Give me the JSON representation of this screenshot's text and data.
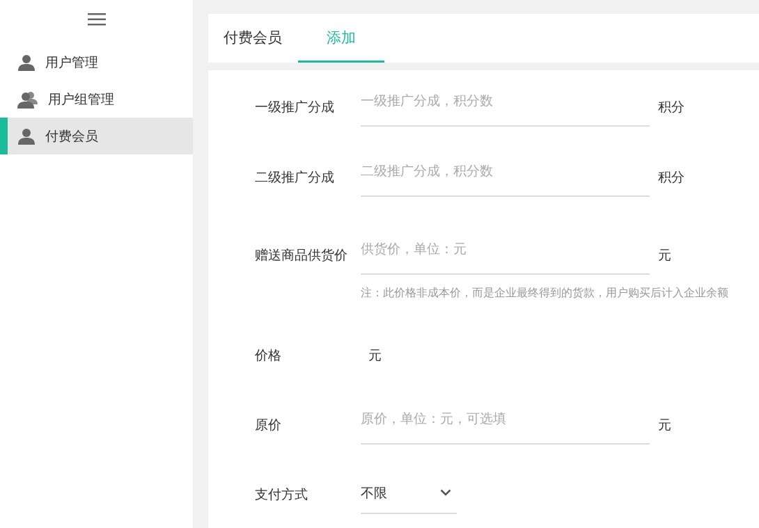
{
  "sidebar": {
    "items": [
      {
        "label": "用户管理",
        "kind": "user",
        "selected": false
      },
      {
        "label": "用户组管理",
        "kind": "group",
        "selected": false
      },
      {
        "label": "付费会员",
        "kind": "user",
        "selected": true
      }
    ]
  },
  "tabs": [
    {
      "label": "付费会员",
      "selected": false
    },
    {
      "label": "添加",
      "selected": true
    }
  ],
  "form": {
    "fields": [
      {
        "kind": "input",
        "label": "一级推广分成",
        "placeholder": "一级推广分成，积分数",
        "unit": "积分"
      },
      {
        "kind": "input",
        "label": "二级推广分成",
        "placeholder": "二级推广分成，积分数",
        "unit": "积分"
      },
      {
        "kind": "input",
        "label": "赠送商品供货价",
        "placeholder": "供货价，单位：元",
        "unit": "元",
        "note": "注：此价格非成本价，而是企业最终得到的货款，用户购买后计入企业余额"
      },
      {
        "kind": "text",
        "label": "价格",
        "unit": "元"
      },
      {
        "kind": "input",
        "label": "原价",
        "placeholder": "原价，单位：元，可选填",
        "unit": "元"
      },
      {
        "kind": "select",
        "label": "支付方式",
        "value": "不限"
      }
    ]
  }
}
